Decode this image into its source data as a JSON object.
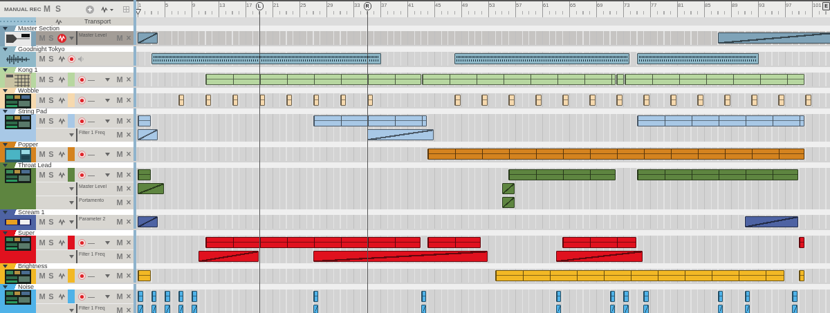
{
  "toolbar": {
    "rec_mode": "MANUAL REC",
    "mute": "M",
    "solo": "S"
  },
  "ruler": {
    "bar_labels": [
      "1",
      "5",
      "9",
      "13",
      "17",
      "21",
      "25",
      "29",
      "33",
      "37",
      "41",
      "45",
      "49",
      "53",
      "57",
      "61",
      "65",
      "69",
      "73",
      "77",
      "81",
      "85",
      "89",
      "93",
      "97",
      "101"
    ],
    "markers": [
      {
        "kind": "locator",
        "label": "L"
      },
      {
        "kind": "locator",
        "label": "R"
      },
      {
        "kind": "end",
        "label": "E"
      }
    ]
  },
  "transport": {
    "name": "Transport"
  },
  "tracks": [
    {
      "name": "Master Section",
      "color": "#7fa3b8",
      "kind": "master",
      "mute": "M",
      "solo": "S",
      "automation_on": true,
      "lanes": [
        {
          "kind": "automation",
          "param": "Master Level",
          "mute": "M",
          "remove": "×"
        }
      ]
    },
    {
      "name": "Goodnight Tokyo",
      "color": "#8fb8c8",
      "kind": "wave",
      "mute": "M",
      "solo": "S",
      "automation_on": false,
      "lanes": [
        {
          "kind": "audio"
        }
      ]
    },
    {
      "name": "Kong 1",
      "color": "#b7d7a0",
      "kind": "pads",
      "mute": "M",
      "solo": "S",
      "automation_on": false,
      "lanes": [
        {
          "kind": "note",
          "dash": "—",
          "mute": "M",
          "remove": "×"
        }
      ]
    },
    {
      "name": "Wobble",
      "color": "#f6d9ae",
      "kind": "rack",
      "mute": "M",
      "solo": "S",
      "automation_on": false,
      "lanes": [
        {
          "kind": "note",
          "dash": "—",
          "mute": "M",
          "remove": "×"
        }
      ]
    },
    {
      "name": "String Pad",
      "color": "#a8c8e6",
      "kind": "rack",
      "mute": "M",
      "solo": "S",
      "automation_on": false,
      "lanes": [
        {
          "kind": "note",
          "dash": "—",
          "mute": "M",
          "remove": "×"
        },
        {
          "kind": "automation",
          "param": "Filter 1 Freq",
          "mute": "M",
          "remove": "×"
        }
      ]
    },
    {
      "name": "Popper",
      "color": "#d4831f",
      "kind": "panel",
      "mute": "M",
      "solo": "S",
      "automation_on": false,
      "lanes": [
        {
          "kind": "note",
          "dash": "—",
          "mute": "M",
          "remove": "×"
        }
      ]
    },
    {
      "name": "Throat Lead",
      "color": "#5e8540",
      "kind": "rack",
      "mute": "M",
      "solo": "S",
      "automation_on": false,
      "lanes": [
        {
          "kind": "note",
          "dash": "—",
          "mute": "M",
          "remove": "×"
        },
        {
          "kind": "automation",
          "param": "Master Level",
          "mute": "M",
          "remove": "×"
        },
        {
          "kind": "automation",
          "param": "Portamento",
          "mute": "M",
          "remove": "×"
        }
      ]
    },
    {
      "name": "Scream 1",
      "color": "#4e63a3",
      "kind": "strip",
      "mute": "M",
      "solo": "S",
      "automation_on": false,
      "lanes": [
        {
          "kind": "automation",
          "param": "Parameter 2",
          "mute": "M",
          "remove": "×"
        }
      ]
    },
    {
      "name": "Super",
      "color": "#e0111e",
      "kind": "rack",
      "mute": "M",
      "solo": "S",
      "automation_on": false,
      "lanes": [
        {
          "kind": "note",
          "dash": "—",
          "mute": "M",
          "remove": "×"
        },
        {
          "kind": "automation",
          "param": "Filter 1 Freq",
          "mute": "M",
          "remove": "×"
        }
      ]
    },
    {
      "name": "Brightness",
      "color": "#f2b825",
      "kind": "rack",
      "mute": "M",
      "solo": "S",
      "automation_on": false,
      "lanes": [
        {
          "kind": "note",
          "dash": "—",
          "mute": "M",
          "remove": "×"
        }
      ]
    },
    {
      "name": "Noise",
      "color": "#4fb2e8",
      "kind": "rack",
      "mute": "M",
      "solo": "S",
      "automation_on": false,
      "lanes": [
        {
          "kind": "note",
          "dash": "—",
          "mute": "M",
          "remove": "×"
        },
        {
          "kind": "automation",
          "param": "Filter 1 Freq",
          "mute": "M",
          "remove": "×"
        }
      ]
    }
  ]
}
